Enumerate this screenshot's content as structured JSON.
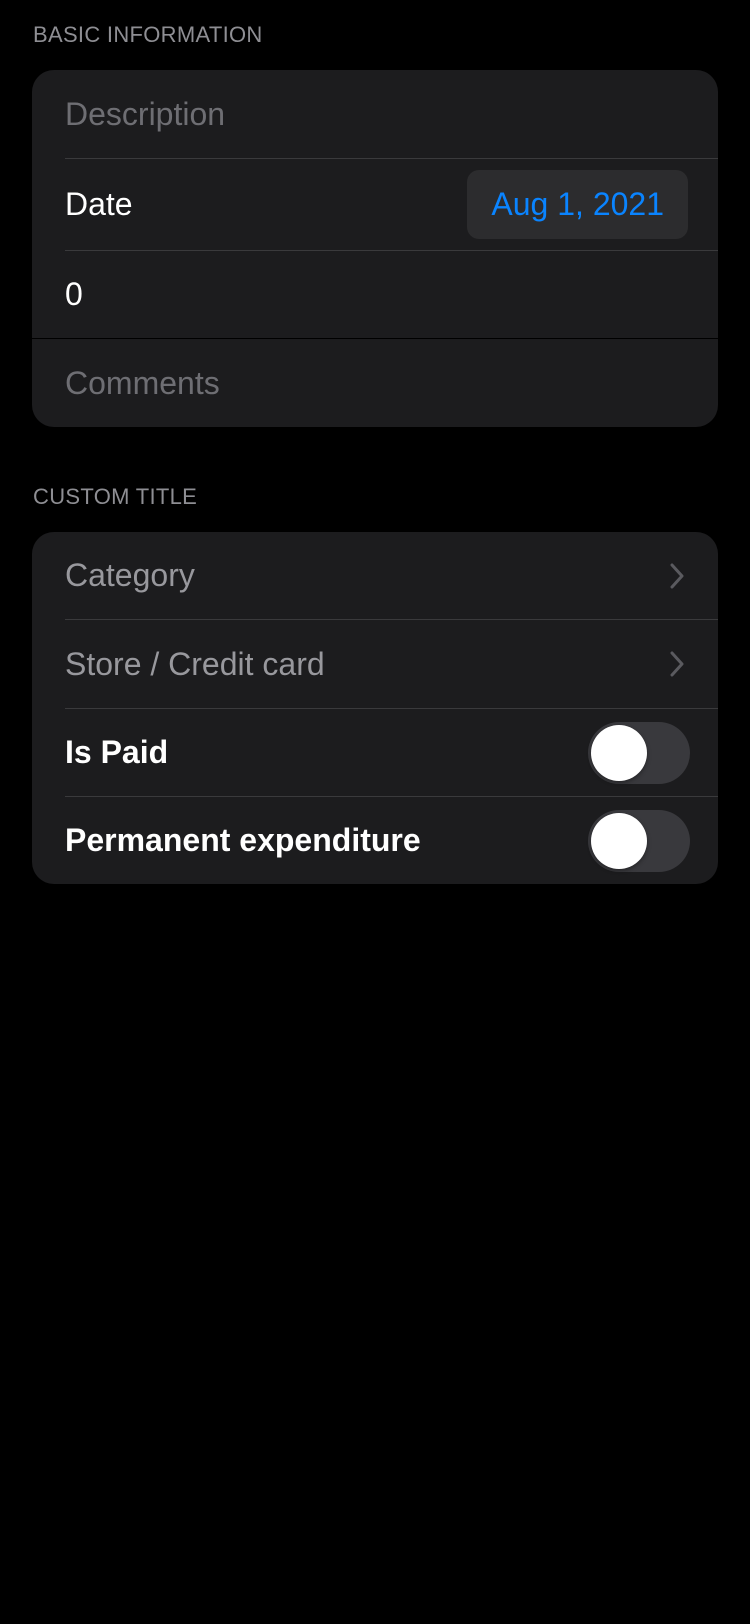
{
  "sections": {
    "basic": {
      "header": "BASIC INFORMATION",
      "description_placeholder": "Description",
      "date_label": "Date",
      "date_value": "Aug 1, 2021",
      "amount_value": "0",
      "comments_placeholder": "Comments"
    },
    "custom": {
      "header": "CUSTOM TITLE",
      "category_label": "Category",
      "store_label": "Store / Credit card",
      "is_paid_label": "Is Paid",
      "is_paid_on": false,
      "permanent_label": "Permanent expenditure",
      "permanent_on": false
    }
  },
  "colors": {
    "background": "#000000",
    "cell": "#1c1c1e",
    "accent": "#0a84ff",
    "secondary_text": "#8e8e93"
  },
  "icons": {
    "chevron": "chevron-right-icon"
  }
}
